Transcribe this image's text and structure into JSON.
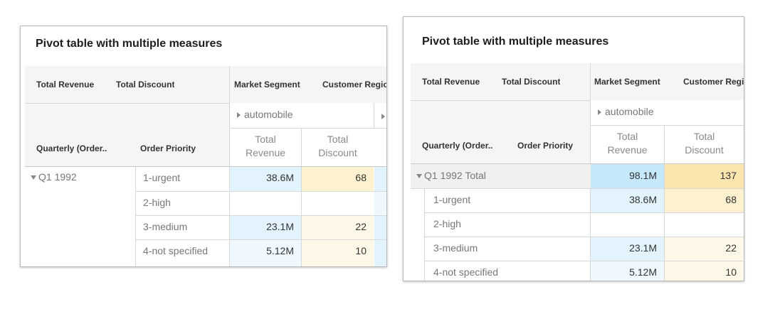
{
  "colors": {
    "revenue_strong": "#c5e8fb",
    "revenue_light": "#e2f3fd",
    "revenue_faint": "#eef8fe",
    "discount_strong": "#fbe6b0",
    "discount_light": "#fdf1cf",
    "discount_faint": "#fef8e8",
    "header_bg": "#f5f5f5"
  },
  "left": {
    "title": "Pivot table with multiple measures",
    "value_fields": [
      "Total Revenue",
      "Total Discount"
    ],
    "column_fields": [
      "Market Segment",
      "Customer Regio"
    ],
    "row_fields": [
      "Quarterly (Order..",
      "Order Priority"
    ],
    "segment": "automobile",
    "measures": [
      "Total\nRevenue",
      "Total\nDiscount"
    ],
    "group": "Q1 1992",
    "rows": [
      {
        "label": "1-urgent",
        "revenue": "38.6M",
        "discount": "68"
      },
      {
        "label": "2-high",
        "revenue": "",
        "discount": ""
      },
      {
        "label": "3-medium",
        "revenue": "23.1M",
        "discount": "22"
      },
      {
        "label": "4-not specified",
        "revenue": "5.12M",
        "discount": "10"
      }
    ]
  },
  "right": {
    "title": "Pivot table with multiple measures",
    "value_fields": [
      "Total Revenue",
      "Total Discount"
    ],
    "column_fields": [
      "Market Segment",
      "Customer Regio"
    ],
    "row_fields": [
      "Quarterly (Order..",
      "Order Priority"
    ],
    "segment": "automobile",
    "measures": [
      "Total\nRevenue",
      "Total\nDiscount"
    ],
    "group_total": {
      "label": "Q1 1992 Total",
      "revenue": "98.1M",
      "discount": "137"
    },
    "rows": [
      {
        "label": "1-urgent",
        "revenue": "38.6M",
        "discount": "68"
      },
      {
        "label": "2-high",
        "revenue": "",
        "discount": ""
      },
      {
        "label": "3-medium",
        "revenue": "23.1M",
        "discount": "22"
      },
      {
        "label": "4-not specified",
        "revenue": "5.12M",
        "discount": "10"
      }
    ]
  }
}
